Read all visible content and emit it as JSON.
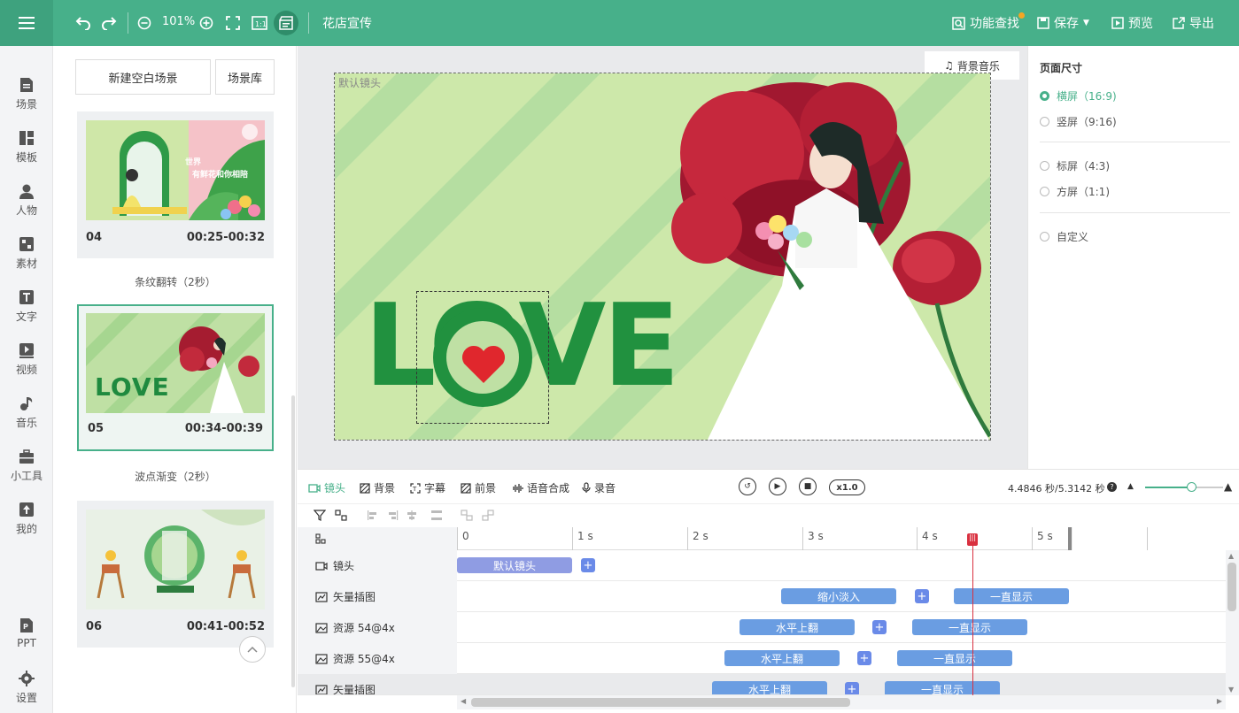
{
  "toolbar": {
    "zoom": "101%",
    "project_title": "花店宣传",
    "find_label": "功能查找",
    "save_label": "保存",
    "preview_label": "预览",
    "export_label": "导出"
  },
  "sidebar": {
    "items": [
      {
        "label": "场景",
        "icon": "scene-icon"
      },
      {
        "label": "模板",
        "icon": "template-icon"
      },
      {
        "label": "人物",
        "icon": "person-icon"
      },
      {
        "label": "素材",
        "icon": "material-icon"
      },
      {
        "label": "文字",
        "icon": "text-icon"
      },
      {
        "label": "视频",
        "icon": "video-icon"
      },
      {
        "label": "音乐",
        "icon": "music-icon"
      },
      {
        "label": "小工具",
        "icon": "toolbox-icon"
      },
      {
        "label": "我的",
        "icon": "my-upload-icon"
      },
      {
        "label": "PPT",
        "icon": "ppt-icon"
      },
      {
        "label": "设置",
        "icon": "settings-icon"
      }
    ]
  },
  "scenes": {
    "new_blank_label": "新建空白场景",
    "library_label": "场景库",
    "cards": [
      {
        "num": "04",
        "time": "00:25-00:32",
        "thumb_text_1": "世界",
        "thumb_text_2": "有鲜花和你相陪"
      },
      {
        "num": "05",
        "time": "00:34-00:39",
        "thumb_text_1": "LOVE"
      },
      {
        "num": "06",
        "time": "00:41-00:52"
      }
    ],
    "transitions": [
      "条纹翻转（2秒）",
      "波点渐变（2秒）"
    ]
  },
  "canvas": {
    "default_lens_label": "默认镜头",
    "bg_music_label": "背景音乐",
    "love_text": "LOVE"
  },
  "page_size": {
    "title": "页面尺寸",
    "options": [
      {
        "label": "横屏（16:9)",
        "selected": true
      },
      {
        "label": "竖屏（9:16)",
        "selected": false
      },
      {
        "label": "标屏（4:3)",
        "selected": false
      },
      {
        "label": "方屏（1:1)",
        "selected": false
      },
      {
        "label": "自定义",
        "selected": false
      }
    ]
  },
  "timeline": {
    "tabs": [
      "镜头",
      "背景",
      "字幕",
      "前景",
      "语音合成",
      "录音"
    ],
    "speed": "x1.0",
    "time_display": "4.4846 秒/5.3142 秒",
    "ruler": [
      "0",
      "1 s",
      "2 s",
      "3 s",
      "4 s",
      "5 s"
    ],
    "rows": [
      {
        "name": "镜头",
        "clips": [
          "默认镜头"
        ]
      },
      {
        "name": "矢量插图",
        "clips": [
          "缩小淡入",
          "一直显示"
        ]
      },
      {
        "name": "资源 54@4x",
        "clips": [
          "水平上翻",
          "一直显示"
        ]
      },
      {
        "name": "资源 55@4x",
        "clips": [
          "水平上翻",
          "一直显示"
        ]
      },
      {
        "name": "矢量插图",
        "clips": [
          "水平上翻",
          "一直显示"
        ]
      }
    ]
  },
  "colors": {
    "brand": "#47b08a",
    "clip": "#6a9de2",
    "playhead": "#d9303f"
  }
}
